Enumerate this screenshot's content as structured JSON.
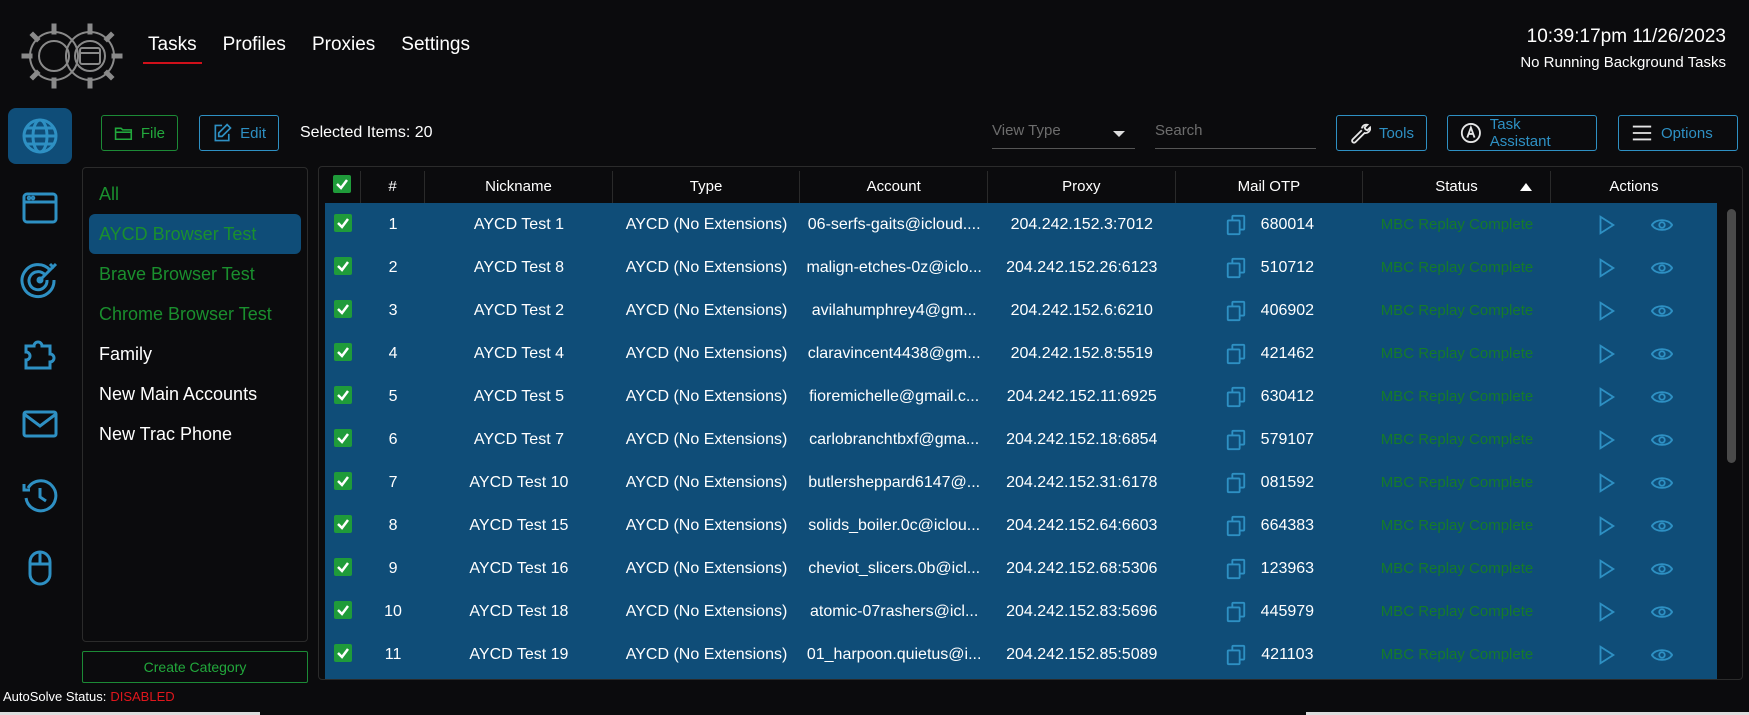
{
  "nav": {
    "tabs": [
      "Tasks",
      "Profiles",
      "Proxies",
      "Settings"
    ],
    "active": "Tasks"
  },
  "header": {
    "datetime": "10:39:17pm 11/26/2023",
    "background_status": "No Running Background Tasks"
  },
  "sidebar_icons": [
    "globe-icon",
    "browser-window-icon",
    "target-icon",
    "puzzle-icon",
    "mail-icon",
    "history-icon",
    "mouse-icon"
  ],
  "toolbar": {
    "file_label": "File",
    "edit_label": "Edit",
    "selected_text": "Selected Items: 20",
    "view_type_placeholder": "View Type",
    "search_placeholder": "Search",
    "tools_label": "Tools",
    "assistant_label": "Task Assistant",
    "options_label": "Options"
  },
  "categories": [
    {
      "label": "All",
      "color": "green"
    },
    {
      "label": "AYCD Browser Test",
      "color": "green",
      "active": true
    },
    {
      "label": "Brave Browser Test",
      "color": "green"
    },
    {
      "label": "Chrome Browser Test",
      "color": "green"
    },
    {
      "label": "Family",
      "color": "white"
    },
    {
      "label": "New Main Accounts",
      "color": "white"
    },
    {
      "label": "New Trac Phone",
      "color": "white"
    }
  ],
  "create_category_label": "Create Category",
  "table": {
    "headers": [
      "#",
      "Nickname",
      "Type",
      "Account",
      "Proxy",
      "Mail OTP",
      "Status",
      "Actions"
    ],
    "sort_column": "Status",
    "rows": [
      {
        "num": "1",
        "nickname": "AYCD Test 1",
        "type": "AYCD (No Extensions)",
        "account": "06-serfs-gaits@icloud....",
        "proxy": "204.242.152.3:7012",
        "otp": "680014",
        "status": "MBC Replay Complete"
      },
      {
        "num": "2",
        "nickname": "AYCD Test 8",
        "type": "AYCD (No Extensions)",
        "account": "malign-etches-0z@iclo...",
        "proxy": "204.242.152.26:6123",
        "otp": "510712",
        "status": "MBC Replay Complete"
      },
      {
        "num": "3",
        "nickname": "AYCD Test 2",
        "type": "AYCD (No Extensions)",
        "account": "avilahumphrey4@gm...",
        "proxy": "204.242.152.6:6210",
        "otp": "406902",
        "status": "MBC Replay Complete"
      },
      {
        "num": "4",
        "nickname": "AYCD Test 4",
        "type": "AYCD (No Extensions)",
        "account": "claravincent4438@gm...",
        "proxy": "204.242.152.8:5519",
        "otp": "421462",
        "status": "MBC Replay Complete"
      },
      {
        "num": "5",
        "nickname": "AYCD Test 5",
        "type": "AYCD (No Extensions)",
        "account": "fioremichelle@gmail.c...",
        "proxy": "204.242.152.11:6925",
        "otp": "630412",
        "status": "MBC Replay Complete"
      },
      {
        "num": "6",
        "nickname": "AYCD Test 7",
        "type": "AYCD (No Extensions)",
        "account": "carlobranchtbxf@gma...",
        "proxy": "204.242.152.18:6854",
        "otp": "579107",
        "status": "MBC Replay Complete"
      },
      {
        "num": "7",
        "nickname": "AYCD Test 10",
        "type": "AYCD (No Extensions)",
        "account": "butlersheppard6147@...",
        "proxy": "204.242.152.31:6178",
        "otp": "081592",
        "status": "MBC Replay Complete"
      },
      {
        "num": "8",
        "nickname": "AYCD Test 15",
        "type": "AYCD (No Extensions)",
        "account": "solids_boiler.0c@iclou...",
        "proxy": "204.242.152.64:6603",
        "otp": "664383",
        "status": "MBC Replay Complete"
      },
      {
        "num": "9",
        "nickname": "AYCD Test 16",
        "type": "AYCD (No Extensions)",
        "account": "cheviot_slicers.0b@icl...",
        "proxy": "204.242.152.68:5306",
        "otp": "123963",
        "status": "MBC Replay Complete"
      },
      {
        "num": "10",
        "nickname": "AYCD Test 18",
        "type": "AYCD (No Extensions)",
        "account": "atomic-07rashers@icl...",
        "proxy": "204.242.152.83:5696",
        "otp": "445979",
        "status": "MBC Replay Complete"
      },
      {
        "num": "11",
        "nickname": "AYCD Test 19",
        "type": "AYCD (No Extensions)",
        "account": "01_harpoon.quietus@i...",
        "proxy": "204.242.152.85:5089",
        "otp": "421103",
        "status": "MBC Replay Complete"
      }
    ]
  },
  "footer": {
    "autosolve_label": "AutoSolve Status:",
    "autosolve_value": "DISABLED"
  },
  "colors": {
    "accent_blue": "#2e90c3",
    "selected_bg": "#0f4d78",
    "green": "#1a8f2e",
    "red": "#d0101a"
  }
}
